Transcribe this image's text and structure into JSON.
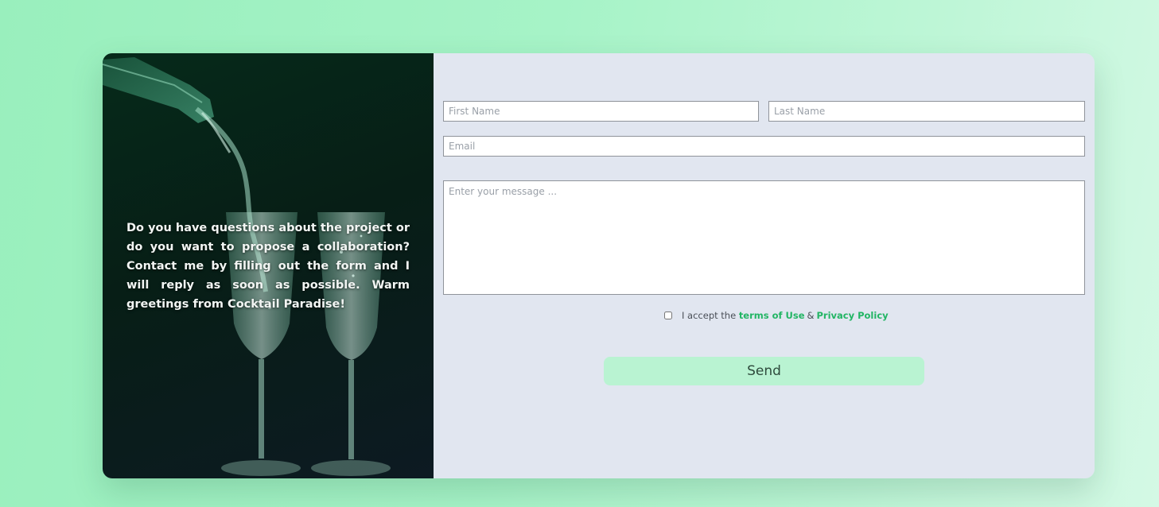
{
  "intro": {
    "text": "Do you have questions about the project or do you want to propose a collaboration? Contact me by filling out the form and I will reply as soon as possible. Warm greetings from Cocktail Paradise!"
  },
  "form": {
    "first_name_placeholder": "First Name",
    "last_name_placeholder": "Last Name",
    "email_placeholder": "Email",
    "message_placeholder": "Enter your message ...",
    "consent": {
      "prefix": "I accept the",
      "terms_link": "terms of Use",
      "separator": "&",
      "privacy_link": "Privacy Policy",
      "checked": false
    },
    "send_label": "Send"
  },
  "colors": {
    "accent": "#22b564",
    "button_bg": "#b9f3d2",
    "panel_bg": "#e1e6f0"
  }
}
